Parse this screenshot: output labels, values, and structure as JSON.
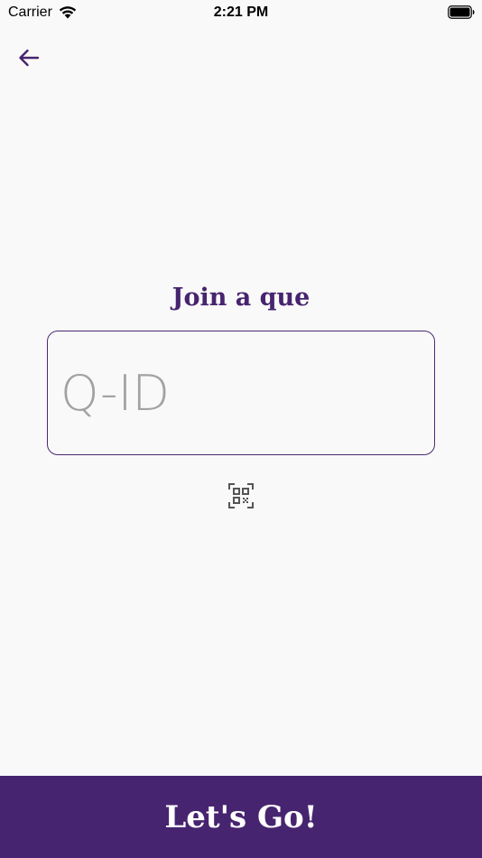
{
  "status_bar": {
    "carrier": "Carrier",
    "time": "2:21 PM"
  },
  "nav": {
    "back_icon": "arrow-left-icon"
  },
  "join": {
    "title": "Join a que",
    "input_placeholder": "Q-ID",
    "input_value": "",
    "scan_icon": "qr-scan-icon"
  },
  "footer": {
    "go_label": "Let's Go!"
  },
  "colors": {
    "brand": "#47246f",
    "background": "#f9f9f9",
    "placeholder": "#a2a2a2"
  }
}
